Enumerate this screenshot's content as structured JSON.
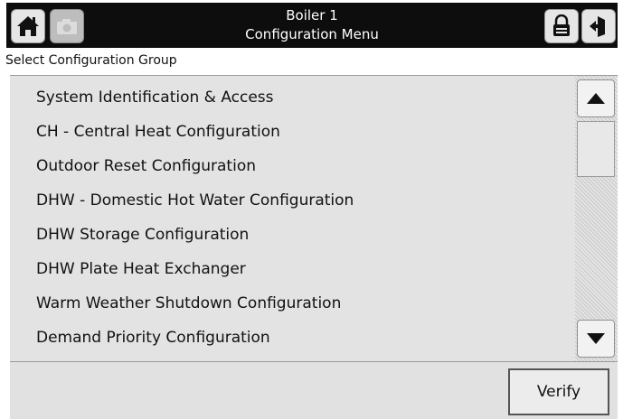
{
  "header": {
    "title_line1": "Boiler 1",
    "title_line2": "Configuration Menu",
    "icons": [
      "home-icon",
      "camera-icon",
      "lock-icon",
      "exit-icon"
    ]
  },
  "subtitle": "Select Configuration Group",
  "config_groups": [
    "System Identification & Access",
    "CH - Central Heat Configuration",
    "Outdoor Reset Configuration",
    "DHW - Domestic Hot Water Configuration",
    "DHW Storage Configuration",
    "DHW Plate Heat Exchanger",
    "Warm Weather Shutdown Configuration",
    "Demand Priority Configuration"
  ],
  "footer": {
    "verify_label": "Verify"
  },
  "colors": {
    "titlebar": "#0d0d0d",
    "panel": "#e3e3e3",
    "footer": "#e1e1e1"
  }
}
